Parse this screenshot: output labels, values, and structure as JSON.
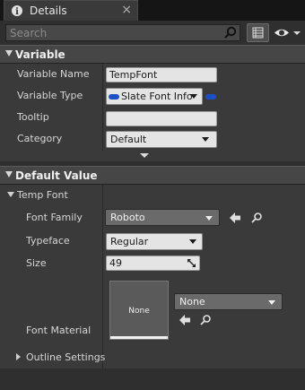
{
  "tab": {
    "title": "Details",
    "close": "×"
  },
  "search": {
    "placeholder": "Search",
    "value": ""
  },
  "sections": {
    "variable": {
      "label": "Variable",
      "rows": {
        "name": {
          "label": "Variable Name",
          "value": "TempFont"
        },
        "type": {
          "label": "Variable Type",
          "value": "Slate Font Info"
        },
        "tooltip": {
          "label": "Tooltip",
          "value": ""
        },
        "category": {
          "label": "Category",
          "value": "Default"
        }
      }
    },
    "default_value": {
      "label": "Default Value",
      "struct_label": "Temp Font",
      "rows": {
        "font_family": {
          "label": "Font Family",
          "value": "Roboto"
        },
        "typeface": {
          "label": "Typeface",
          "value": "Regular"
        },
        "size": {
          "label": "Size",
          "value": "49"
        },
        "font_material": {
          "label": "Font Material",
          "thumbnail_label": "None",
          "value": "None"
        },
        "outline": {
          "label": "Outline Settings"
        }
      }
    }
  },
  "colors": {
    "pin_blue": "#1b4fc4",
    "panel_bg": "#3a3a3a",
    "header_bg": "#464646"
  },
  "icons": {
    "tab": "details-icon",
    "search": "search-icon",
    "grid": "property-matrix-icon",
    "eye": "view-options-icon",
    "use_selected": "arrow-left-icon",
    "browse": "magnifier-icon"
  }
}
